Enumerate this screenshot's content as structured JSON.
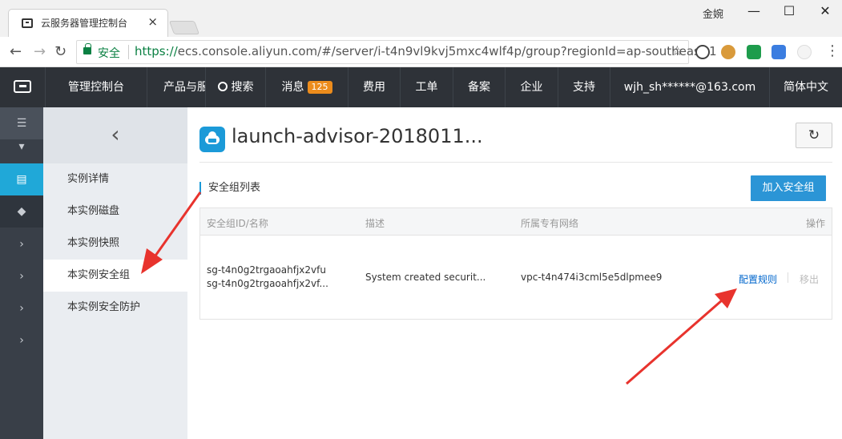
{
  "browser": {
    "tab_title": "云服务器管理控制台",
    "tab_close": "×",
    "user_name": "金婉",
    "window_controls": {
      "minimize": "—",
      "maximize": "☐",
      "close": "✕"
    },
    "security_label": "安全",
    "url_scheme": "https://",
    "url_rest": "ecs.console.aliyun.com/#/server/i-t4n9vl9kvj5mxc4wlf4p/group?regionId=ap-southeast-1",
    "nav": {
      "back": "←",
      "forward": "→",
      "reload": "↻",
      "bookmark": "☆",
      "menu": "⋮"
    }
  },
  "topnav": {
    "items": [
      {
        "label": "管理控制台"
      },
      {
        "label": "产品与服"
      },
      {
        "label": "搜索",
        "icon": "search-icon"
      },
      {
        "label": "消息",
        "badge": "125"
      },
      {
        "label": "费用"
      },
      {
        "label": "工单"
      },
      {
        "label": "备案"
      },
      {
        "label": "企业"
      },
      {
        "label": "支持"
      },
      {
        "label": "wjh_sh******@163.com"
      },
      {
        "label": "简体中文"
      }
    ]
  },
  "iconbar": {
    "items": [
      "☰",
      "▾",
      "▤",
      "◆",
      "›",
      "›",
      "›",
      "›"
    ]
  },
  "sidemenu": {
    "back": "‹",
    "items": [
      {
        "label": "实例详情"
      },
      {
        "label": "本实例磁盘"
      },
      {
        "label": "本实例快照"
      },
      {
        "label": "本实例安全组"
      },
      {
        "label": "本实例安全防护"
      }
    ]
  },
  "main": {
    "title": "launch-advisor-2018011...",
    "refresh": "↻",
    "section_title": "安全组列表",
    "add_button": "加入安全组",
    "table": {
      "headers": [
        "安全组ID/名称",
        "描述",
        "所属专有网络",
        "操作"
      ],
      "rows": [
        {
          "id": "sg-t4n0g2trgaoahfjx2vfu",
          "name": "sg-t4n0g2trgaoahfjx2vf...",
          "description": "System created securit...",
          "vpc": "vpc-t4n474i3cml5e5dlpmee9",
          "action_configure": "配置规则",
          "action_remove": "移出"
        }
      ]
    }
  },
  "colors": {
    "accent": "#2b95d6",
    "topnav_bg": "#2e3238",
    "arrow": "#e8332d",
    "badge": "#ec8c1c"
  }
}
